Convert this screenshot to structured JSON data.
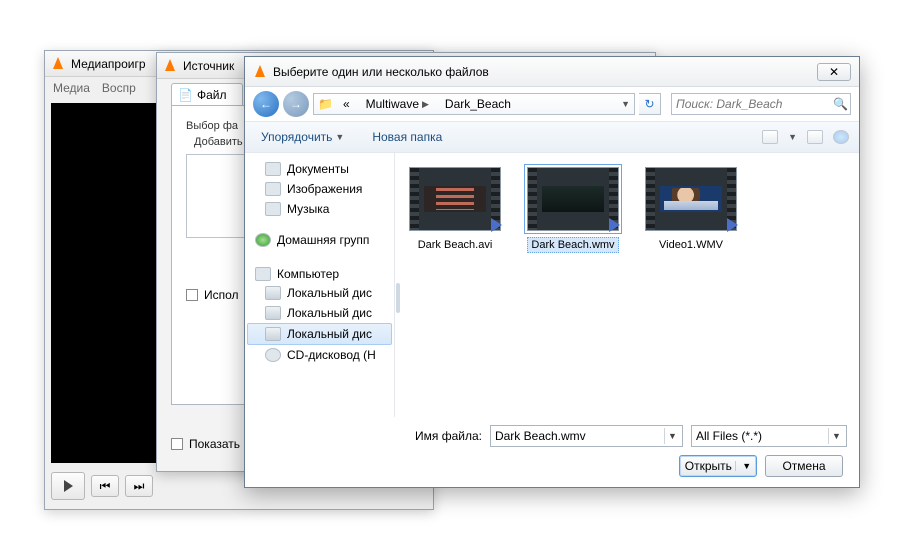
{
  "vlc": {
    "title": "Медиапроигр",
    "menu": {
      "media": "Медиа",
      "playback": "Воспр"
    }
  },
  "source_window": {
    "title": "Источник",
    "tab_file": "Файл",
    "section": "Выбор фа",
    "add_label": "Добавить",
    "use_checkbox": "Испол",
    "show_more": "Показать"
  },
  "dialog": {
    "title": "Выберите один или несколько файлов",
    "breadcrumb": {
      "prefix": "«",
      "seg1": "Multiwave",
      "seg2": "Dark_Beach"
    },
    "search_placeholder": "Поиск: Dark_Beach",
    "toolbar": {
      "organize": "Упорядочить",
      "new_folder": "Новая папка"
    },
    "nav": {
      "libraries": {
        "documents": "Документы",
        "pictures": "Изображения",
        "music": "Музыка"
      },
      "homegroup": "Домашняя групп",
      "computer": "Компьютер",
      "drives": [
        "Локальный дис",
        "Локальный дис",
        "Локальный дис"
      ],
      "cd": "CD-дисковод (Н"
    },
    "files": [
      {
        "name": "Dark Beach.avi",
        "kind": "dark-text"
      },
      {
        "name": "Dark Beach.wmv",
        "kind": "dark",
        "selected": true
      },
      {
        "name": "Video1.WMV",
        "kind": "news"
      }
    ],
    "footer": {
      "filename_label": "Имя файла:",
      "filename_value": "Dark Beach.wmv",
      "filter": "All Files (*.*)",
      "open": "Открыть",
      "cancel": "Отмена"
    }
  }
}
